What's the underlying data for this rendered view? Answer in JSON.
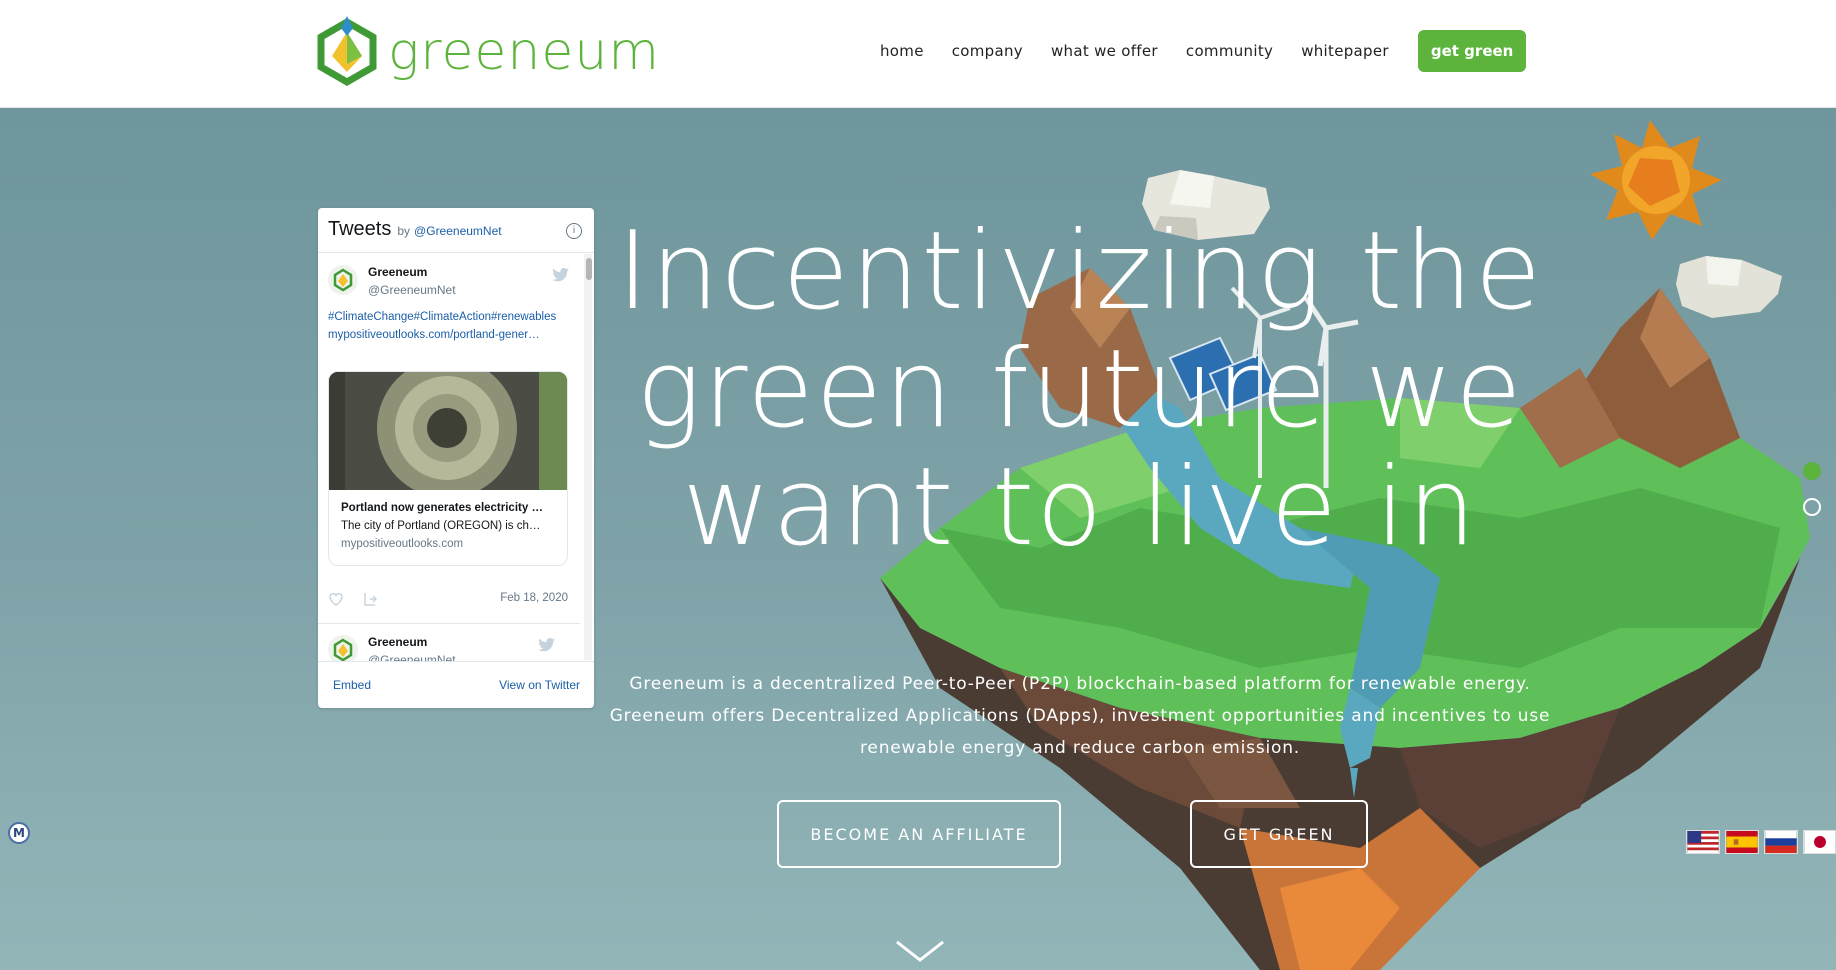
{
  "brand": {
    "name": "greeneum",
    "accent": "#5cb43c"
  },
  "nav": {
    "items": [
      {
        "label": "home"
      },
      {
        "label": "company"
      },
      {
        "label": "what we offer"
      },
      {
        "label": "community"
      },
      {
        "label": "whitepaper"
      }
    ],
    "cta": "get green"
  },
  "twitter": {
    "title": "Tweets",
    "by": "by",
    "handle": "@GreeneumNet",
    "info_icon": "info-icon",
    "tweets": [
      {
        "name": "Greeneum",
        "user": "@GreeneumNet",
        "hashtags": "#ClimateChange#ClimateAction#renewables",
        "link": "mypositiveoutlooks.com/portland-gener…",
        "card_title": "Portland now generates electricity …",
        "card_desc": "The city of Portland (OREGON) is ch…",
        "card_url": "mypositiveoutlooks.com",
        "date": "Feb 18, 2020"
      },
      {
        "name": "Greeneum",
        "user": "@GreeneumNet"
      }
    ],
    "footer": {
      "embed": "Embed",
      "view": "View on Twitter"
    }
  },
  "hero": {
    "headline": [
      "Incentivizing the",
      "green future we",
      "want to live in"
    ],
    "subcopy": [
      "Greeneum is a decentralized Peer-to-Peer (P2P) blockchain-based platform for renewable energy.",
      "Greeneum offers Decentralized Applications (DApps), investment opportunities and incentives to use",
      "renewable energy and reduce carbon emission."
    ],
    "buttons": {
      "affiliate": "BECOME AN AFFILIATE",
      "get_green": "GET GREEN"
    }
  },
  "badge": {
    "letter": "M"
  },
  "languages": [
    "us-flag",
    "es-flag",
    "ru-flag",
    "jp-flag"
  ]
}
